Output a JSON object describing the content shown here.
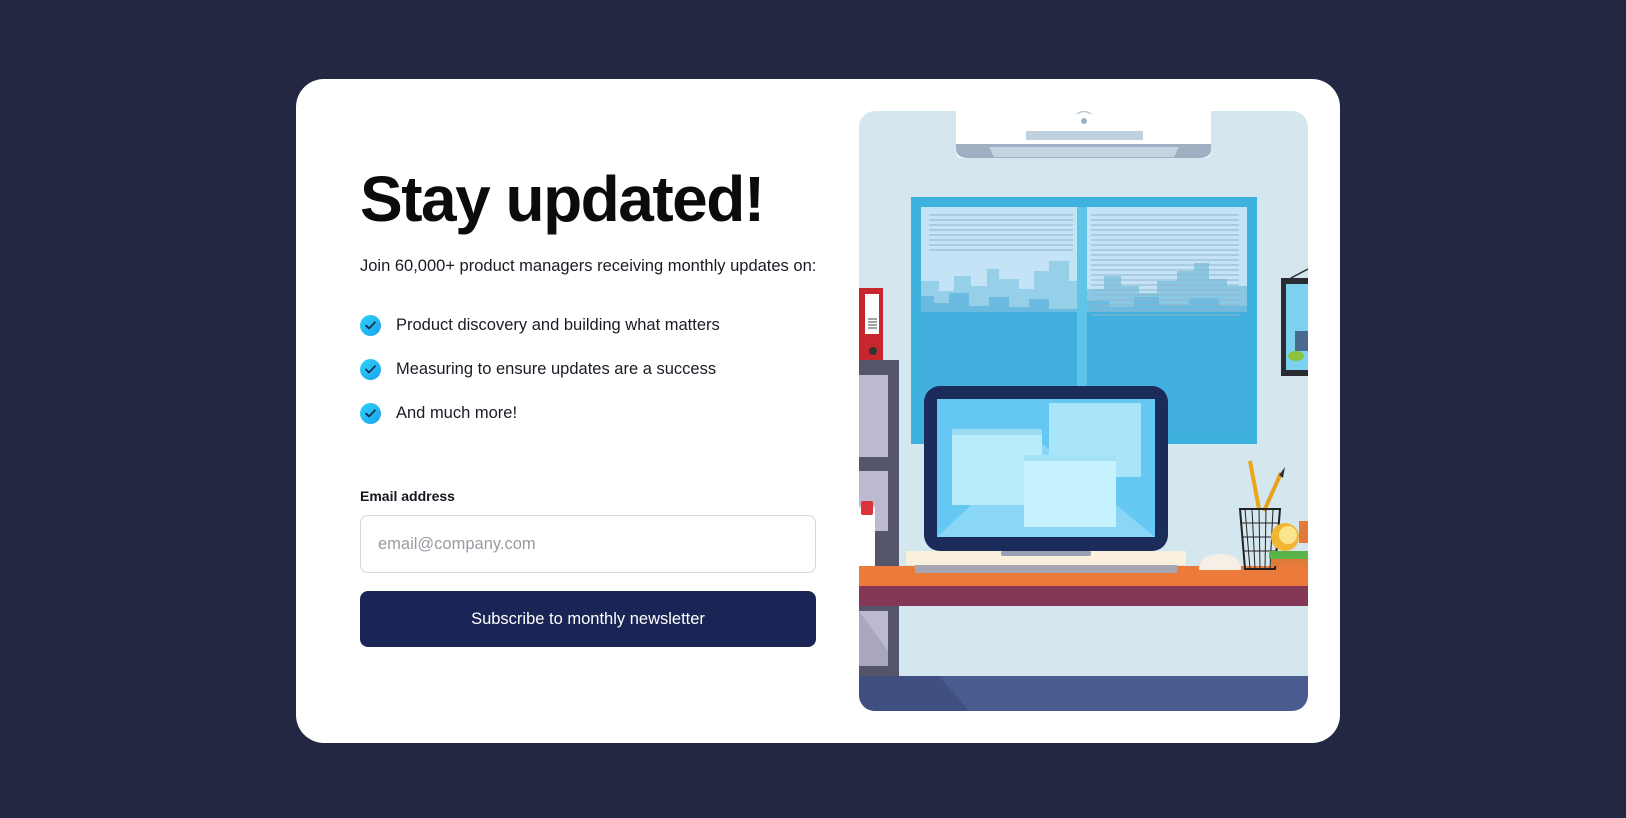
{
  "newsletter": {
    "title": "Stay updated!",
    "intro": "Join 60,000+ product managers receiving monthly updates on:",
    "features": [
      "Product discovery and building what matters",
      "Measuring to ensure updates are a success",
      "And much more!"
    ],
    "email_label": "Email address",
    "email_placeholder": "email@company.com",
    "email_value": "",
    "subscribe_label": "Subscribe to monthly newsletter"
  },
  "icons": {
    "feature_check": "check-circle-icon"
  },
  "colors": {
    "page_background": "#242742",
    "card_background": "#ffffff",
    "button_background": "#1a2556",
    "check_gradient_start": "#2fd4f5",
    "check_gradient_end": "#1aa0f0"
  }
}
